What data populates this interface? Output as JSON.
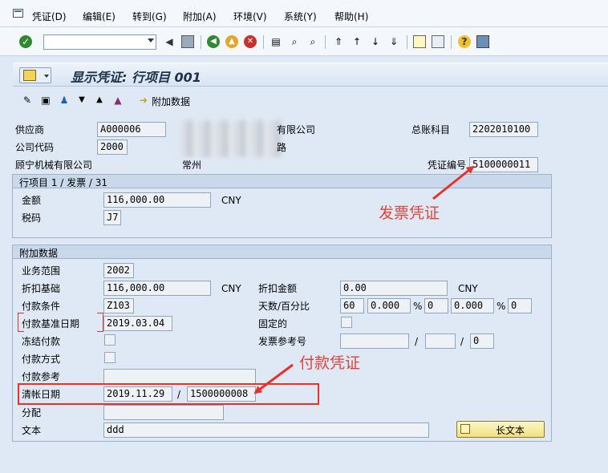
{
  "menu": {
    "items": [
      "凭证(D)",
      "编辑(E)",
      "转到(G)",
      "附加(A)",
      "环境(V)",
      "系统(Y)",
      "帮助(H)"
    ]
  },
  "toolbar": {
    "command_value": ""
  },
  "title": "显示凭证: 行项目 001",
  "app_toolbar": {
    "additional_data_label": "附加数据"
  },
  "header": {
    "vendor_label": "供应商",
    "vendor_value": "A000006",
    "company_label": "公司代码",
    "company_value": "2000",
    "name_partial": "有限公司",
    "street_partial": "路",
    "vendor_name": "顾宁机械有限公司",
    "city": "常州",
    "gl_label": "总账科目",
    "gl_value": "2202010100",
    "doc_no_label": "凭证编号",
    "doc_no_value": "5100000011"
  },
  "line_item_group": {
    "title": "行项目 1 / 发票 / 31",
    "amount_label": "金额",
    "amount_value": "116,000.00",
    "currency": "CNY",
    "tax_label": "税码",
    "tax_value": "J7"
  },
  "additional_group": {
    "title": "附加数据",
    "business_area_label": "业务范围",
    "business_area_value": "2002",
    "discount_base_label": "折扣基础",
    "discount_base_value": "116,000.00",
    "discount_base_currency": "CNY",
    "discount_amount_label": "折扣金额",
    "discount_amount_value": "0.00",
    "discount_amount_currency": "CNY",
    "payment_terms_label": "付款条件",
    "payment_terms_value": "Z103",
    "days_pct_label": "天数/百分比",
    "days1": "60",
    "pct1": "0.000",
    "pct_sign1": "%",
    "days2": "0",
    "pct2": "0.000",
    "pct_sign2": "%",
    "days3": "0",
    "baseline_date_label": "付款基准日期",
    "baseline_date_value": "2019.03.04",
    "fixed_label": "固定的",
    "frozen_label": "冻结付款",
    "invoice_ref_label": "发票参考号",
    "invoice_ref_sep1": "/",
    "invoice_ref_sep2": "/",
    "invoice_ref_last": "0",
    "payment_method_label": "付款方式",
    "payment_ref_label": "付款参考",
    "clearing_date_label": "清帐日期",
    "clearing_date_value": "2019.11.29",
    "clearing_sep": "/",
    "clearing_doc_value": "1500000008",
    "assignment_label": "分配",
    "text_label": "文本",
    "text_value": "ddd",
    "long_text_button": "长文本"
  },
  "annotations": {
    "invoice_doc": "发票凭证",
    "payment_doc": "付款凭证"
  },
  "colors": {
    "annotation_red": "#e0443a",
    "background": "#dfe9f5"
  }
}
